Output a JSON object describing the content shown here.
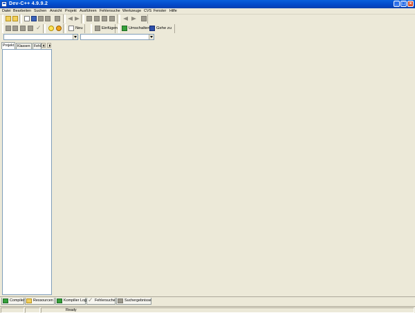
{
  "window": {
    "title": "Dev-C++ 4.9.9.2",
    "controls": [
      "minimize",
      "maximize",
      "close"
    ]
  },
  "menu": [
    "Datei",
    "Bearbeiten",
    "Suchen",
    "Ansicht",
    "Projekt",
    "Ausführen",
    "Fehlersuche",
    "Werkzeuge",
    "CVS",
    "Fenster",
    "Hilfe"
  ],
  "toolbar": {
    "new_label": "Neu",
    "insert_label": "Einfügen",
    "toggle_label": "Umschalten",
    "goto_label": "Gehe zu"
  },
  "combos": {
    "class_combo": "",
    "member_combo": ""
  },
  "left_tabs": [
    "Projekt",
    "Klassen",
    "Fehl"
  ],
  "bottom_tabs": [
    {
      "label": "Compiler",
      "icon": "compiler-icon"
    },
    {
      "label": "Ressourcen",
      "icon": "resources-icon"
    },
    {
      "label": "Kompilier Log",
      "icon": "compile-log-icon"
    },
    {
      "label": "Fehlersuche",
      "icon": "debug-icon"
    },
    {
      "label": "Suchergebnisse",
      "icon": "search-results-icon"
    }
  ],
  "status": {
    "text": "Ready"
  }
}
